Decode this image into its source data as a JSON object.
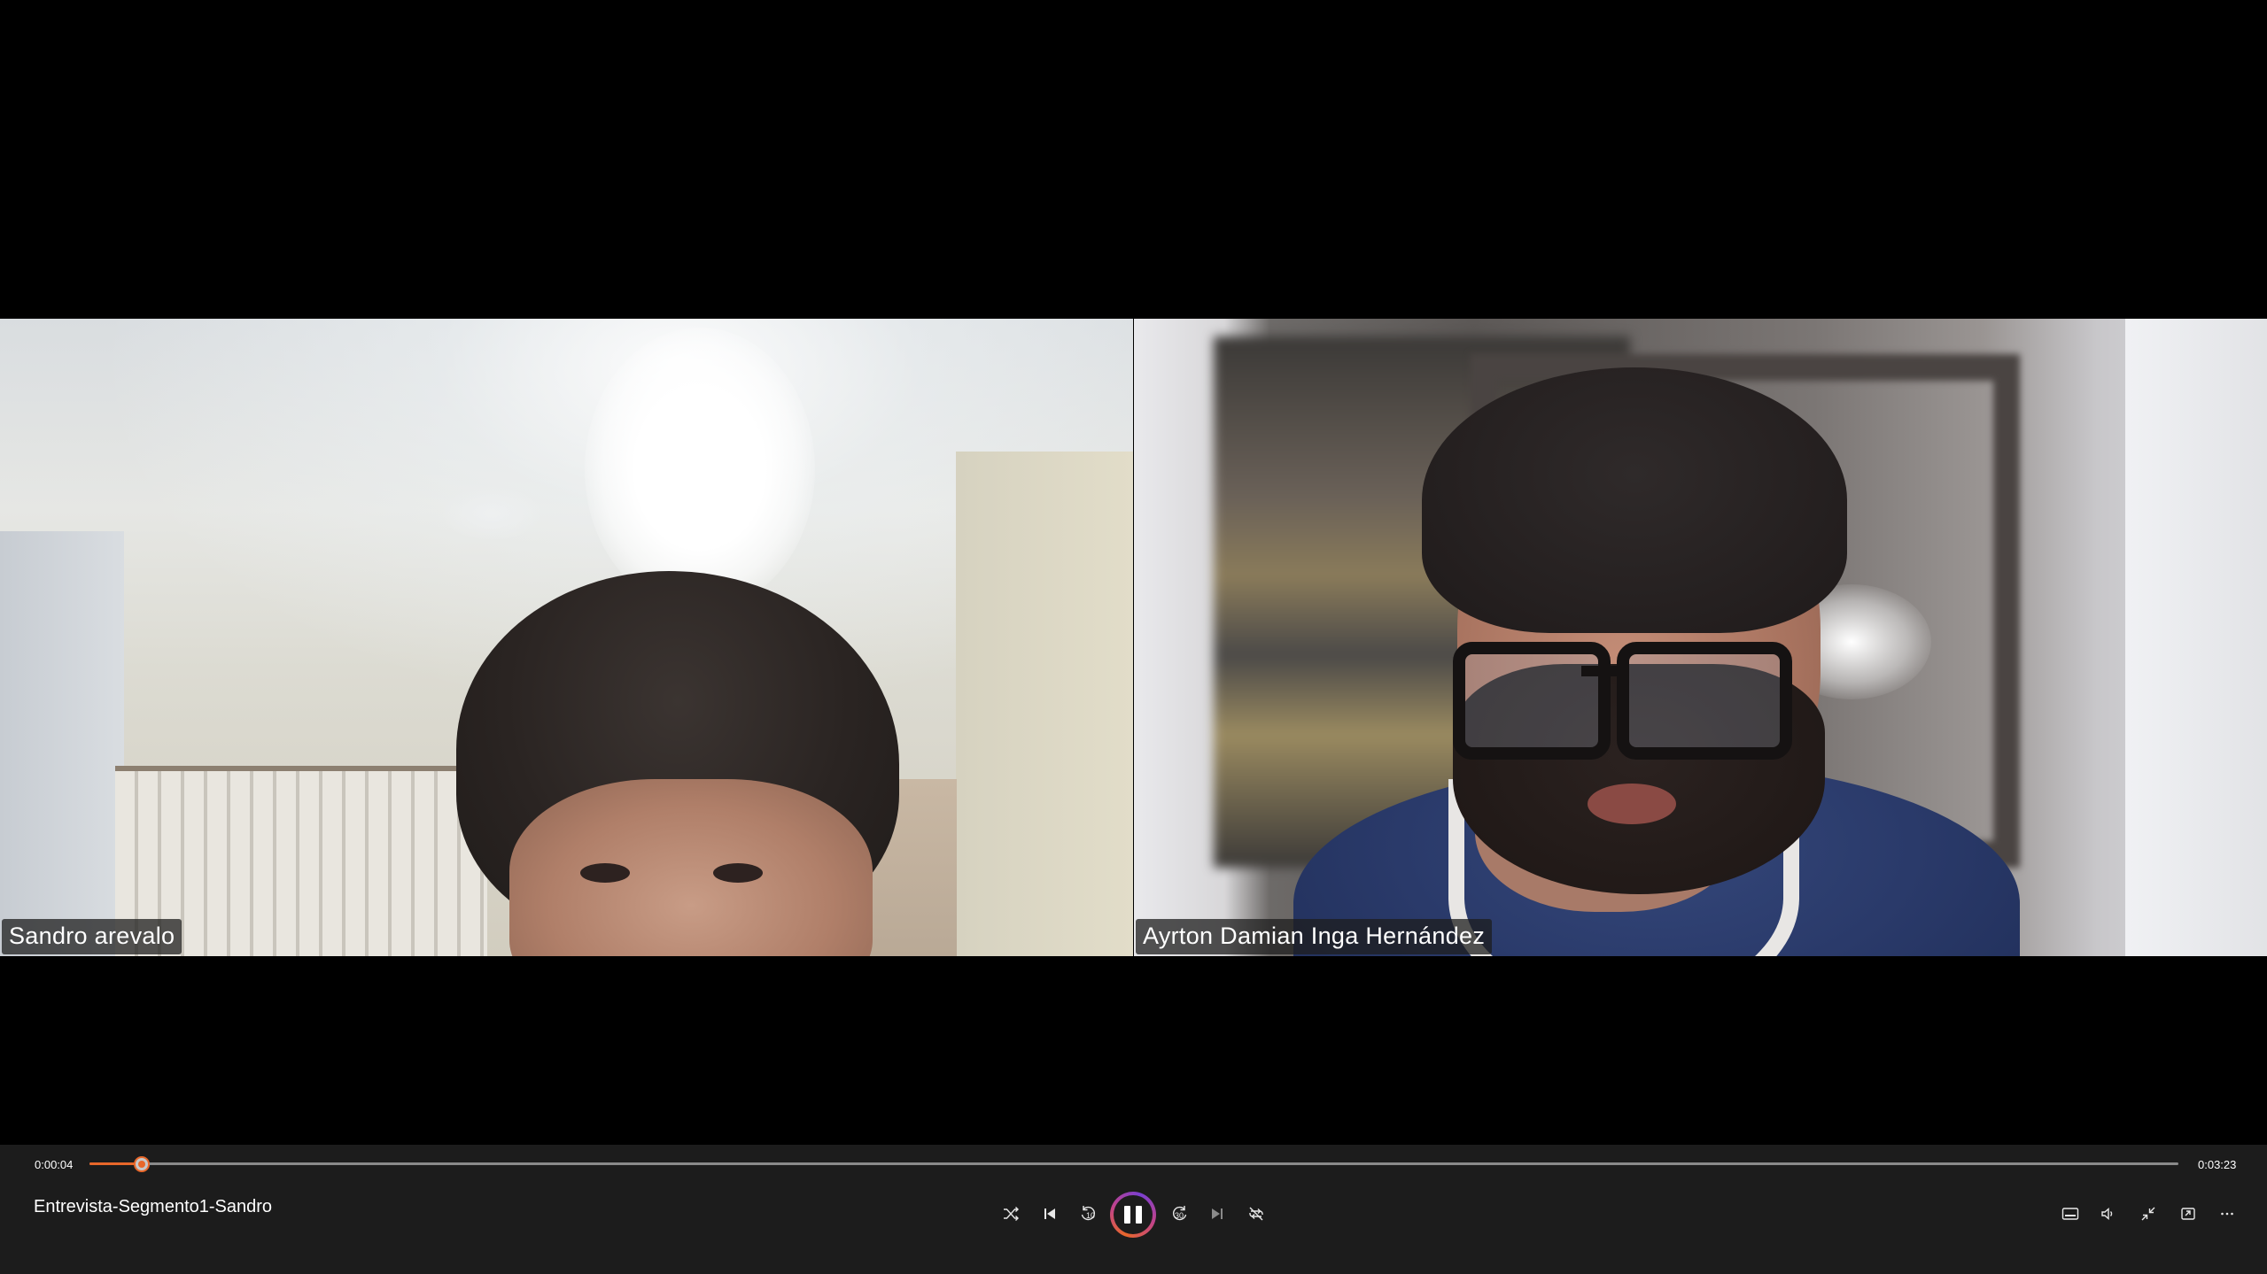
{
  "player": {
    "title": "Entrevista-Segmento1-Sandro",
    "current_time": "0:00:04",
    "total_time": "0:03:23",
    "progress_fraction": 0.025,
    "accent_color": "#e8672a"
  },
  "participants": [
    {
      "name": "Sandro arevalo"
    },
    {
      "name": "Ayrton Damian Inga Hernández"
    }
  ],
  "controls": {
    "shuffle_icon": "shuffle-icon",
    "previous_icon": "previous-icon",
    "rewind_label": "10",
    "play_pause_state": "playing",
    "forward_label": "30",
    "next_icon": "next-icon",
    "repeat_icon": "repeat-off-icon",
    "right_icons": [
      "subtitles-icon",
      "volume-icon",
      "exit-fullscreen-icon",
      "mini-player-icon",
      "more-icon"
    ]
  }
}
